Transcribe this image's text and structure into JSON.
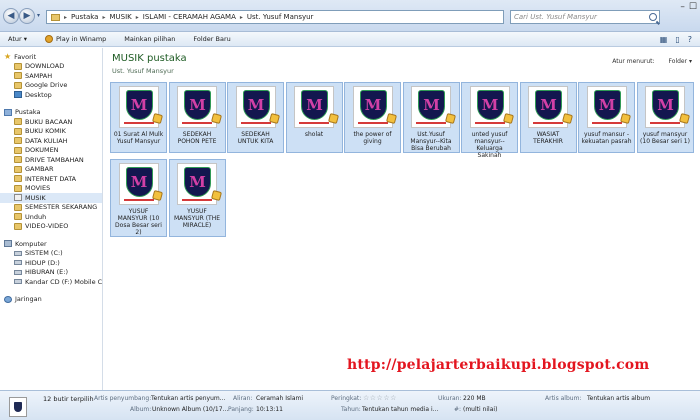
{
  "address": {
    "crumbs": [
      "Pustaka",
      "MUSIK",
      "ISLAMI - CERAMAH AGAMA",
      "Ust. Yusuf Mansyur"
    ],
    "search_placeholder": "Cari Ust. Yusuf Mansyur"
  },
  "toolbar": {
    "organize": "Atur ▾",
    "play": "Play in Winamp",
    "play_all": "Mainkan pilihan",
    "new_folder": "Folder Baru"
  },
  "sidebar": {
    "favorites_header": "Favorit",
    "favorites": [
      "DOWNLOAD",
      "SAMPAH",
      "Google Drive",
      "Desktop"
    ],
    "libraries_header": "Pustaka",
    "libraries": [
      "BUKU BACAAN",
      "BUKU KOMIK",
      "DATA KULIAH",
      "DOKUMEN",
      "DRIVE TAMBAHAN",
      "GAMBAR",
      "INTERNET DATA",
      "MOVIES",
      "MUSIK",
      "SEMESTER SEKARANG",
      "Unduh",
      "VIDEO-VIDEO"
    ],
    "computer_header": "Komputer",
    "drives": [
      "SISTEM (C:)",
      "HIDUP (D:)",
      "HIBURAN (E:)",
      "Kandar CD (F:) Mobile Co"
    ],
    "network_header": "Jaringan"
  },
  "content": {
    "title": "MUSIK pustaka",
    "subtitle": "Ust. Yusuf Mansyur",
    "arrange_label": "Atur menurut:",
    "arrange_value": "Folder ▾",
    "thumb_letter": "M",
    "items": [
      "01 Surat Al Mulk Yusuf Mansyur",
      "SEDEKAH POHON PETE",
      "SEDEKAH UNTUK KITA",
      "sholat",
      "the power of giving",
      "Ust.Yusuf Mansyur--Kita Bisa Berubah",
      "unted yusuf mansyur--Keluarga Sakinah",
      "WASIAT TERAKHIR",
      "yusuf mansur - kekuatan pasrah",
      "yusuf mansyur (10 Besar seri 1)",
      "YUSUF MANSYUR (10 Dosa Besar seri 2)",
      "YUSUF MANSYUR (THE MIRACLE)"
    ]
  },
  "watermark": "http://pelajarterbaikupi.blogspot.com",
  "details": {
    "count": "12 butir terpilih",
    "artist_label": "Artis penyumbang:",
    "artist_value": "Tentukan artis penyum...",
    "album_label": "Album:",
    "album_value": "Unknown Album (10/17...",
    "genre_label": "Aliran:",
    "genre_value": "Ceramah Islami",
    "length_label": "Panjang:",
    "length_value": "10:13:11",
    "rating_label": "Peringkat:",
    "rating_stars": "☆☆☆☆☆",
    "year_label": "Tahun:",
    "year_value": "Tentukan tahun media i...",
    "size_label": "Ukuran:",
    "size_value": "220 MB",
    "num_label": "#:",
    "num_value": "(multi nilai)",
    "album_artist_label": "Artis album:",
    "album_artist_value": "Tentukan artis album"
  }
}
